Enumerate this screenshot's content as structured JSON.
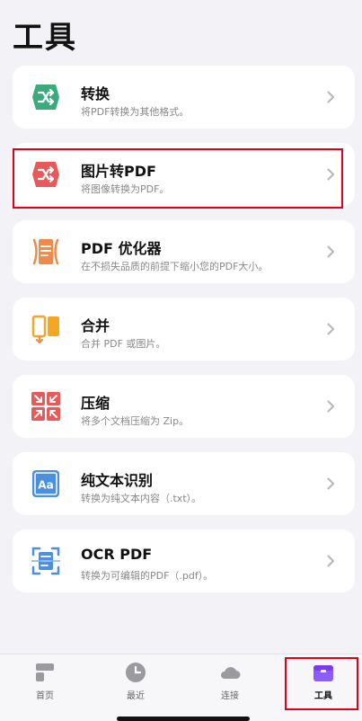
{
  "page": {
    "title": "工具"
  },
  "tools": [
    {
      "title": "转换",
      "desc": "将PDF转换为其他格式。",
      "icon": "convert-icon",
      "color": "#3daa7e"
    },
    {
      "title": "图片转PDF",
      "desc": "将图像转换为PDF。",
      "icon": "image-to-pdf-icon",
      "color": "#e85a5a"
    },
    {
      "title": "PDF 优化器",
      "desc": "在不损失品质的前提下缩小您的PDF大小。",
      "icon": "optimizer-icon",
      "color": "#f08a4b"
    },
    {
      "title": "合并",
      "desc": "合并 PDF 或图片。",
      "icon": "merge-icon",
      "color": "#f5a623"
    },
    {
      "title": "压缩",
      "desc": "将多个文档压缩为 Zip。",
      "icon": "compress-icon",
      "color": "#e85a5a"
    },
    {
      "title": "纯文本识别",
      "desc": "转换为纯文本内容（.txt）。",
      "icon": "text-recognition-icon",
      "color": "#4a8fe0"
    },
    {
      "title": "OCR PDF",
      "desc": "转换为可编辑的PDF（.pdf）。",
      "icon": "ocr-icon",
      "color": "#4a8fe0"
    }
  ],
  "tabs": [
    {
      "label": "首页",
      "icon": "home-icon"
    },
    {
      "label": "最近",
      "icon": "clock-icon"
    },
    {
      "label": "连接",
      "icon": "cloud-icon"
    },
    {
      "label": "工具",
      "icon": "toolbox-icon",
      "active": true
    }
  ],
  "colors": {
    "accent": "#8b5cf6",
    "highlight": "#e0001b",
    "inactive_tab": "#9a9a9f"
  }
}
